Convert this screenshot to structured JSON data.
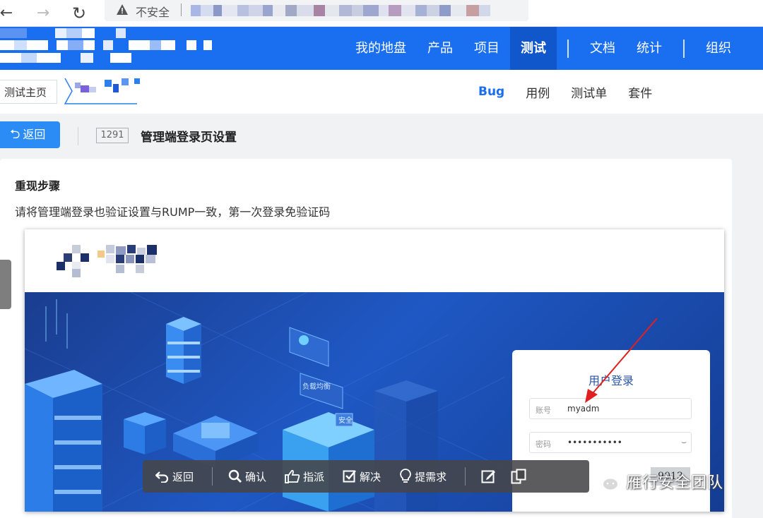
{
  "browser": {
    "insecure_label": "不安全"
  },
  "topnav": {
    "items": [
      "我的地盘",
      "产品",
      "项目",
      "测试",
      "文档",
      "统计",
      "组织"
    ],
    "active": "测试"
  },
  "subnav": {
    "home_crumb": "测试主页",
    "tabs": [
      "Bug",
      "用例",
      "测试单",
      "套件"
    ],
    "active_tab": "Bug"
  },
  "header": {
    "back_label": "返回",
    "bug_id": "1291",
    "bug_title": "管理端登录页设置"
  },
  "content": {
    "steps_title": "重现步骤",
    "steps_text": "请将管理端登录也验证设置与RUMP一致，第一次登录免验证码"
  },
  "embedded_login": {
    "title": "用户登录",
    "account_label": "账号",
    "account_value": "myadm",
    "password_label": "密码",
    "password_value": "•••••••••••",
    "captcha_value": "9013",
    "badge_1": "负载均衡",
    "badge_2": "安全"
  },
  "toolbar": {
    "back": "返回",
    "confirm": "确认",
    "assign": "指派",
    "resolve": "解决",
    "propose": "提需求"
  },
  "watermark": {
    "text": "雁行安全团队"
  },
  "colors": {
    "nav_blue": "#1a6ef0",
    "nav_active": "#1157cc",
    "button_blue": "#2b8cf5",
    "arrow_red": "#e02020"
  }
}
